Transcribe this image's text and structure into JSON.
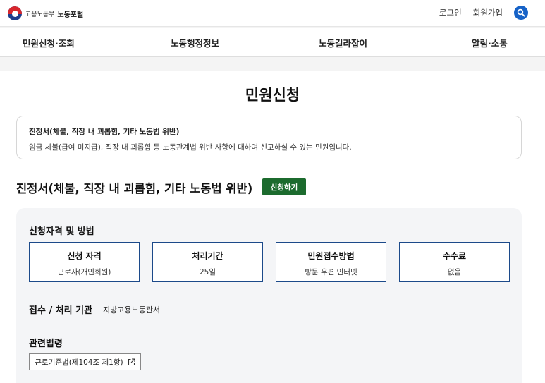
{
  "header": {
    "org": "고용노동부",
    "site_name": "노동포털",
    "login": "로그인",
    "signup": "회원가입"
  },
  "nav": {
    "items": [
      "민원신청·조회",
      "노동행정정보",
      "노동길라잡이",
      "알림·소통"
    ]
  },
  "page": {
    "title": "민원신청"
  },
  "summary": {
    "title": "진정서(체불, 직장 내 괴롭힘, 기타 노동법 위반)",
    "description": "임금 체불(급여 미지급), 직장 내 괴롭힘 등 노동관계법 위반 사항에 대하여 신고하실 수 있는 민원입니다."
  },
  "service": {
    "title": "진정서(체불, 직장 내 괴롭힘, 기타 노동법 위반)",
    "apply_label": "신청하기"
  },
  "eligibility": {
    "section_title": "신청자격 및 방법",
    "cards": [
      {
        "title": "신청 자격",
        "value": "근로자(개인회원)"
      },
      {
        "title": "처리기간",
        "value": "25일"
      },
      {
        "title": "민원접수방법",
        "value": "방문 우편 인터넷"
      },
      {
        "title": "수수료",
        "value": "없음"
      }
    ]
  },
  "agency": {
    "label": "접수 / 처리 기관",
    "value": "지방고용노동관서"
  },
  "laws": {
    "section_title": "관련법령",
    "link_label": "근로기준법(제104조 제1항)"
  },
  "colors": {
    "accent_blue": "#1662c7",
    "apply_green": "#1c6b2e",
    "card_border": "#1c4a8a"
  }
}
